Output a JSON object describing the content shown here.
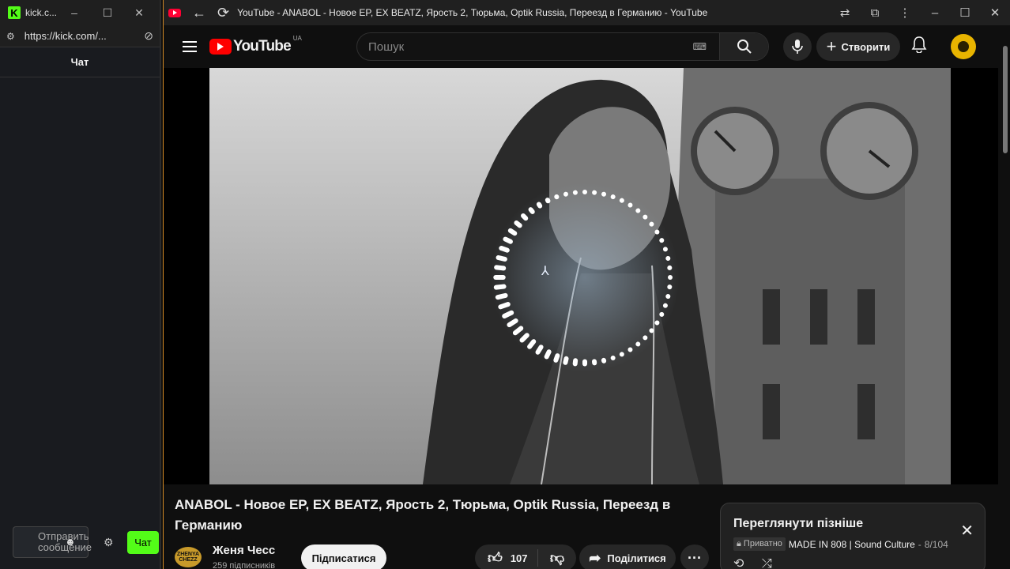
{
  "kick": {
    "logo": "K",
    "window_title": "kick.c...",
    "url": "https://kick.com/...",
    "chat_header": "Чат",
    "message_placeholder": "Отправить сообщение",
    "send_label": "Чат"
  },
  "browser": {
    "tab_title": "YouTube - ANABOL - Новое EP, EX BEATZ, Ярость 2, Тюрьма, Optik Russia, Переезд в Германию - YouTube"
  },
  "youtube": {
    "logo_text": "YouTube",
    "country_code": "UA",
    "search_placeholder": "Пошук",
    "create_label": "Створити",
    "video": {
      "title": "ANABOL - Новое EP, EX BEATZ, Ярость 2, Тюрьма, Optik Russia, Переезд в Германию",
      "channel_name": "Женя Чесс",
      "channel_avatar_text": "ZHENYA CHEZZ",
      "subscribers": "259 підписників",
      "subscribe_label": "Підписатися",
      "likes": "107",
      "share_label": "Поділитися",
      "visualizer_dots": 56
    },
    "watch_later": {
      "title": "Переглянути пізніше",
      "privacy": "Приватно",
      "channel": "MADE IN 808 | Sound Culture",
      "position": "8/104"
    }
  },
  "colors": {
    "kick_green": "#53fc18",
    "youtube_red": "#ff0000",
    "window_accent": "#d48a26"
  }
}
